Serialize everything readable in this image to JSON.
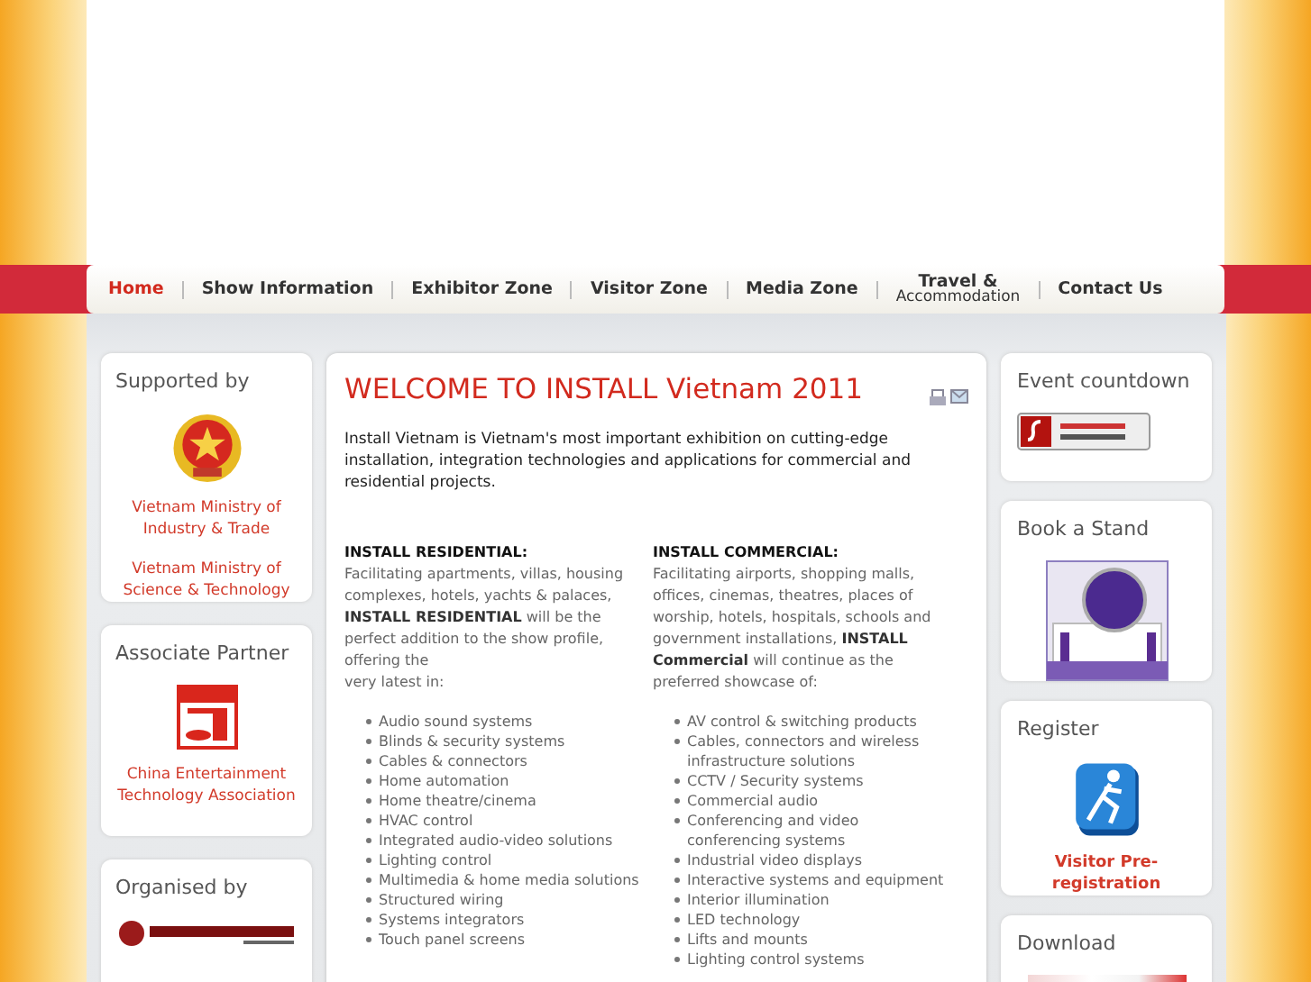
{
  "nav": [
    {
      "label": "Home",
      "selected": true
    },
    {
      "label": "Show Information",
      "selected": false
    },
    {
      "label": "Exhibitor Zone",
      "selected": false
    },
    {
      "label": "Visitor Zone",
      "selected": false
    },
    {
      "label": "Media Zone",
      "selected": false
    },
    {
      "label": "Travel &",
      "sublabel": "Accommodation",
      "selected": false
    },
    {
      "label": "Contact Us",
      "selected": false
    }
  ],
  "left_boxes": [
    {
      "title": "Supported by",
      "kind": "emblem",
      "links": [
        "Vietnam Ministry of Industry & Trade",
        "Vietnam Ministry of Science & Technology"
      ]
    },
    {
      "title": "Associate Partner",
      "kind": "ceta",
      "links": [
        "China Entertainment Technology Association"
      ]
    },
    {
      "title": "Organised by",
      "kind": "iir"
    }
  ],
  "main": {
    "title": "WELCOME TO INSTALL Vietnam 2011",
    "intro": "Install Vietnam is Vietnam's most important exhibition on cutting-edge installation,  integration technologies and applications for commercial and residential projects.",
    "columns": [
      {
        "heading": "INSTALL RESIDENTIAL:",
        "text": "Facilitating apartments, villas, housing complexes, hotels, yachts & palaces, **INSTALL RESIDENTIAL** will be the perfect addition to the show profile, offering the\nvery latest in:",
        "items": [
          "Audio sound systems",
          "Blinds & security systems",
          "Cables & connectors",
          "Home automation",
          "Home theatre/cinema",
          "HVAC control",
          "Integrated audio-video solutions",
          "Lighting control",
          "Multimedia & home media solutions",
          "Structured wiring",
          "Systems integrators",
          "Touch panel screens"
        ]
      },
      {
        "heading": "INSTALL COMMERCIAL:",
        "text": "Facilitating airports, shopping malls, offices, cinemas, theatres, places of worship, hotels, hospitals, schools and government installations, **INSTALL Commercial** will continue as the preferred showcase of:",
        "items": [
          "AV control & switching products",
          "Cables, connectors and wireless infrastructure solutions",
          "CCTV / Security systems",
          "Commercial audio",
          "Conferencing and video conferencing systems",
          "Industrial video displays",
          "Interactive systems and equipment",
          "Interior illumination",
          "LED technology",
          "Lifts and mounts",
          "Lighting control systems"
        ]
      }
    ]
  },
  "right_boxes": [
    {
      "title": "Event countdown",
      "kind": "flash"
    },
    {
      "title": "Book a Stand",
      "kind": "stand"
    },
    {
      "title": "Register",
      "kind": "runner",
      "link": "Visitor Pre-registration"
    },
    {
      "title": "Download",
      "kind": "download"
    }
  ]
}
